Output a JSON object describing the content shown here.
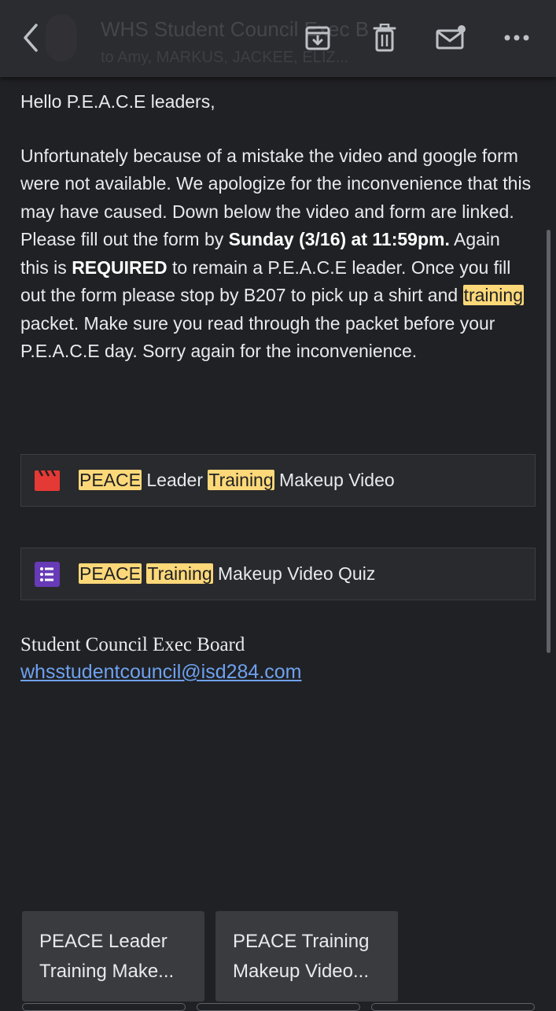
{
  "toolbar": {
    "subject": "WHS Student Council Exec Board",
    "recipients": "to Amy, MARKUS, JACKEE, ELIZ..."
  },
  "body": {
    "greeting": "Hello P.E.A.C.E leaders,",
    "p_part1": "Unfortunately because of a mistake the video and google form were not available. We apologize for the inconvenience that this may have caused. Down below the video and form are linked. Please fill out the form by ",
    "p_deadline": "Sunday (3/16) at 11:59pm.",
    "p_part2": " Again this is ",
    "p_required": "REQUIRED",
    "p_part3": " to remain a P.E.A.C.E leader. Once you fill out the form please stop by B207 to pick up a shirt and ",
    "p_training": "training",
    "p_part4": " packet. Make sure you read through the packet before your P.E.A.C.E day. Sorry again for the inconvenience."
  },
  "attachments": [
    {
      "hl1": "PEACE",
      "mid1": " Leader ",
      "hl2": "Training",
      "rest": " Makeup Video",
      "icon": "video-clapperboard-icon",
      "color": "#e53935"
    },
    {
      "hl1": "PEACE",
      "mid1": " ",
      "hl2": "Training",
      "rest": " Makeup Video Quiz",
      "icon": "forms-list-icon",
      "color": "#673ab7"
    }
  ],
  "signature": {
    "name": "Student Council Exec Board",
    "email": "whsstudentcouncil@isd284.com"
  },
  "suggestions": [
    {
      "line1": "PEACE Leader",
      "line2": "Training Make..."
    },
    {
      "line1": "PEACE Training",
      "line2": "Makeup Video..."
    }
  ],
  "colors": {
    "background": "#202124",
    "highlight": "#fcd879",
    "link": "#6ea1f0"
  }
}
